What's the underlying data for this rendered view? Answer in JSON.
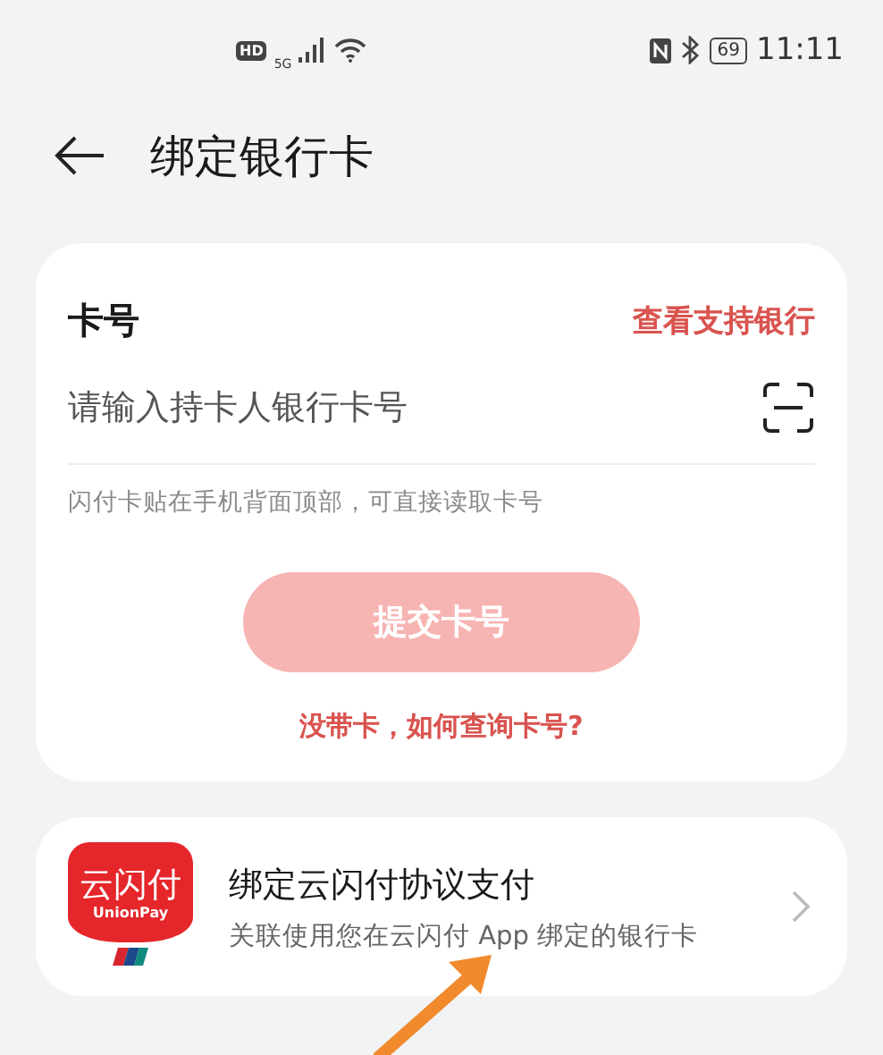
{
  "status_bar": {
    "hd": "HD",
    "network": "5G",
    "battery": "69",
    "time": "11:11"
  },
  "header": {
    "title": "绑定银行卡"
  },
  "card_form": {
    "label": "卡号",
    "link": "查看支持银行",
    "field": {
      "placeholder": "请输入持卡人银行卡号"
    },
    "hint": "闪付卡贴在手机背面顶部，可直接读取卡号",
    "submit": {
      "label": "提交卡号",
      "disabled": true
    },
    "help_link": "没带卡，如何查询卡号?"
  },
  "unionpay_item": {
    "logo_text": "云闪付",
    "logo_sub": "UnionPay",
    "title": "绑定云闪付协议支付",
    "subtitle": "关联使用您在云闪付 App 绑定的银行卡"
  }
}
